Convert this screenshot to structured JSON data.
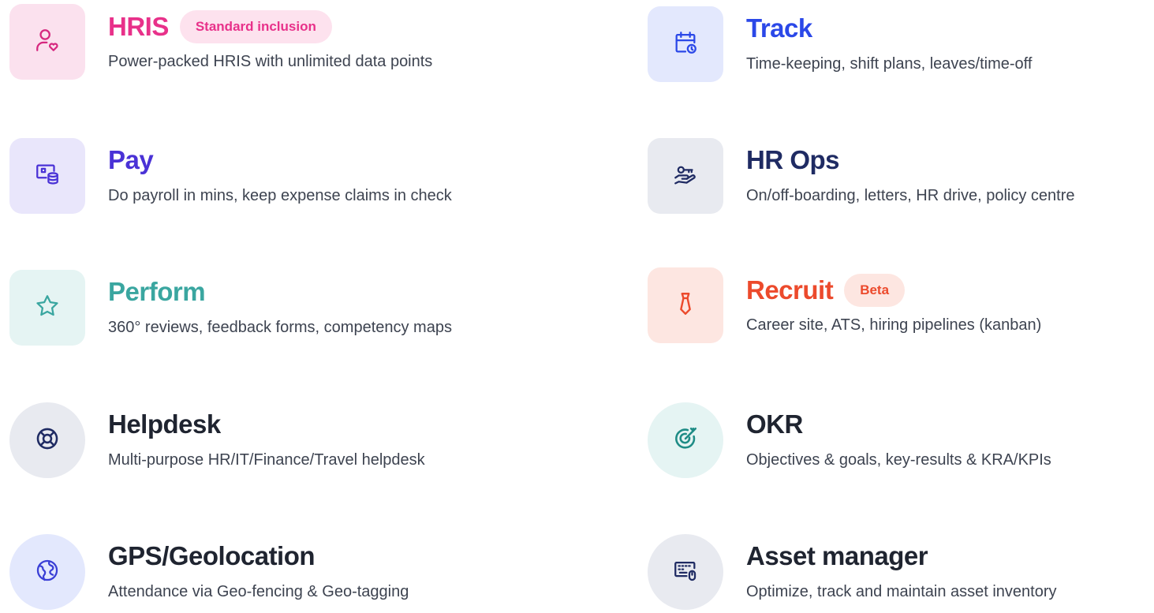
{
  "modules": [
    {
      "key": "hris",
      "title": "HRIS",
      "badge": "Standard inclusion",
      "description": "Power-packed HRIS with unlimited data points",
      "icon": "user-heart-icon",
      "title_color": "#e8318a",
      "icon_color": "#d6287f",
      "icon_bg": "#fbe1ee",
      "badge_bg": "#fde2ee",
      "badge_color": "#e8318a"
    },
    {
      "key": "track",
      "title": "Track",
      "badge": "",
      "description": "Time-keeping, shift plans, leaves/time-off",
      "icon": "calendar-clock-icon",
      "title_color": "#2b48e8",
      "icon_color": "#2b48e8",
      "icon_bg": "#e3e8fd"
    },
    {
      "key": "pay",
      "title": "Pay",
      "badge": "",
      "description": "Do payroll in mins, keep expense claims in check",
      "icon": "payroll-coins-icon",
      "title_color": "#4a32d6",
      "icon_color": "#4a32d6",
      "icon_bg": "#e9e6fb"
    },
    {
      "key": "hr-ops",
      "title": "HR Ops",
      "badge": "",
      "description": "On/off-boarding, letters, HR drive, policy centre",
      "icon": "hand-key-icon",
      "title_color": "#1f2b63",
      "icon_color": "#1f2b63",
      "icon_bg": "#e8eaf0"
    },
    {
      "key": "perform",
      "title": "Perform",
      "badge": "",
      "description": "360° reviews, feedback forms, competency maps",
      "icon": "star-icon",
      "title_color": "#3aa6a0",
      "icon_color": "#3aa6a0",
      "icon_bg": "#e5f4f3"
    },
    {
      "key": "recruit",
      "title": "Recruit",
      "badge": "Beta",
      "description": "Career site, ATS, hiring pipelines (kanban)",
      "icon": "tie-icon",
      "title_color": "#ec4a2c",
      "icon_color": "#ec4a2c",
      "icon_bg": "#fde6e1",
      "badge_bg": "#fde6e1",
      "badge_color": "#ec4a2c"
    },
    {
      "key": "helpdesk",
      "title": "Helpdesk",
      "badge": "",
      "description": "Multi-purpose HR/IT/Finance/Travel helpdesk",
      "icon": "lifebuoy-icon",
      "title_color": "#1f2430",
      "icon_color": "#1f2b63",
      "icon_bg": "#e8eaf0"
    },
    {
      "key": "okr",
      "title": "OKR",
      "badge": "",
      "description": "Objectives & goals, key-results & KRA/KPIs",
      "icon": "target-icon",
      "title_color": "#1f2430",
      "icon_color": "#1f8c86",
      "icon_bg": "#e5f4f3"
    },
    {
      "key": "gps",
      "title": "GPS/Geolocation",
      "badge": "",
      "description": "Attendance via Geo-fencing & Geo-tagging",
      "icon": "globe-icon",
      "title_color": "#1f2430",
      "icon_color": "#3a3fd6",
      "icon_bg": "#e3e8fd"
    },
    {
      "key": "asset-manager",
      "title": "Asset manager",
      "badge": "",
      "description": "Optimize, track and maintain asset inventory",
      "icon": "keyboard-mouse-icon",
      "title_color": "#1f2430",
      "icon_color": "#1f2b63",
      "icon_bg": "#e8eaf0"
    }
  ]
}
